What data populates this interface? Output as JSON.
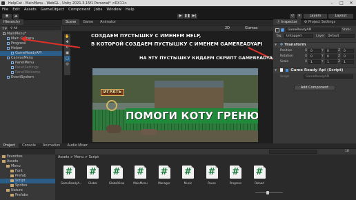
{
  "window": {
    "title": "HelpCat - MainMenu - WebGL - Unity 2021.3.15f1 Personal* <DX11>",
    "min": "–",
    "max": "□",
    "close": "✕"
  },
  "menu": [
    "File",
    "Edit",
    "Assets",
    "GameObject",
    "Component",
    "Jobs",
    "Window",
    "Help"
  ],
  "toolbar": {
    "play": "▶",
    "pause": "❚❚",
    "step": "▶|",
    "layers": "Layers",
    "layout": "Layout"
  },
  "hierarchy": {
    "tab": "Hierarchy",
    "search": "All",
    "items": [
      {
        "label": "MainMenu*",
        "indent": 0,
        "icon": "scene"
      },
      {
        "label": "Main Camera",
        "indent": 1,
        "icon": "cube"
      },
      {
        "label": "Progress",
        "indent": 1,
        "icon": "cube"
      },
      {
        "label": "Helper",
        "indent": 1,
        "icon": "cube"
      },
      {
        "label": "GameReadyAPI",
        "indent": 2,
        "icon": "cube",
        "selected": true
      },
      {
        "label": "CanvasMenu",
        "indent": 1,
        "icon": "cube"
      },
      {
        "label": "PanelMenu",
        "indent": 2,
        "icon": "cube"
      },
      {
        "label": "PanelSettings",
        "indent": 2,
        "icon": "cube",
        "dim": true
      },
      {
        "label": "PanelWelcome",
        "indent": 2,
        "icon": "cube",
        "dim": true
      },
      {
        "label": "EventSystem",
        "indent": 1,
        "icon": "cube"
      }
    ]
  },
  "scene_tabs": [
    "Scene",
    "Game",
    "Animator"
  ],
  "scene_toolbar": {
    "view2d": "2D",
    "gizmos": "Gizmos",
    "persp": "< Persp"
  },
  "overlay": {
    "line1": "СОЗДАЕМ ПУСТЫШКУ С ИМЕНЕМ HELP,",
    "line2": "В КОТОРОЙ СОЗДАЕМ ПУСТЫШКУ С ИМЕНЕМ GAMEREADYAPI",
    "line3": "НА ЭТУ ПУСТЫШКУ КИДАЕМ СКРИПТ GAMEREADYAPI.CS"
  },
  "game": {
    "play_button": "ИГРАТЬ",
    "banner": "ПОМОГИ КОТУ ГРЕНЮ"
  },
  "inspector": {
    "tabs": [
      "Inspector",
      "Project Settings"
    ],
    "object_name": "GameReadyAPI",
    "static": "Static",
    "tag_label": "Tag",
    "tag_value": "Untagged",
    "layer_label": "Layer",
    "layer_value": "Default",
    "transform": "Transform",
    "position_label": "Position",
    "rotation_label": "Rotation",
    "scale_label": "Scale",
    "x": "X",
    "y": "Y",
    "z": "Z",
    "position": [
      "0",
      "0",
      "0"
    ],
    "rotation": [
      "0",
      "0",
      "0"
    ],
    "scale": [
      "1",
      "1",
      "1"
    ],
    "component": "Game Ready Api (Script)",
    "script_label": "Script",
    "script_value": "GameReadyAPI",
    "add_component": "Add Component"
  },
  "bottom_tabs": [
    "Project",
    "Console",
    "Animation",
    "Audio Mixer"
  ],
  "project_tree": [
    {
      "label": "Favorites",
      "indent": 0
    },
    {
      "label": "Assets",
      "indent": 0
    },
    {
      "label": "Menu",
      "indent": 1
    },
    {
      "label": "Font",
      "indent": 2
    },
    {
      "label": "Prefab",
      "indent": 2
    },
    {
      "label": "Script",
      "indent": 2,
      "selected": true
    },
    {
      "label": "Sprites",
      "indent": 2
    },
    {
      "label": "Nature",
      "indent": 1
    },
    {
      "label": "Prefabs",
      "indent": 2
    }
  ],
  "breadcrumb": "Assets > Menu > Script",
  "scripts": [
    "GameReadyA...",
    "Global",
    "GlobalView",
    "MainMenu",
    "Manager",
    "Music",
    "Pause",
    "Progress",
    "Reload"
  ],
  "assets_count": "18",
  "colors": {
    "selection": "#2c5d87",
    "arrow": "#e0302a",
    "banner": "#1f8a3a",
    "panel": "#383838"
  }
}
